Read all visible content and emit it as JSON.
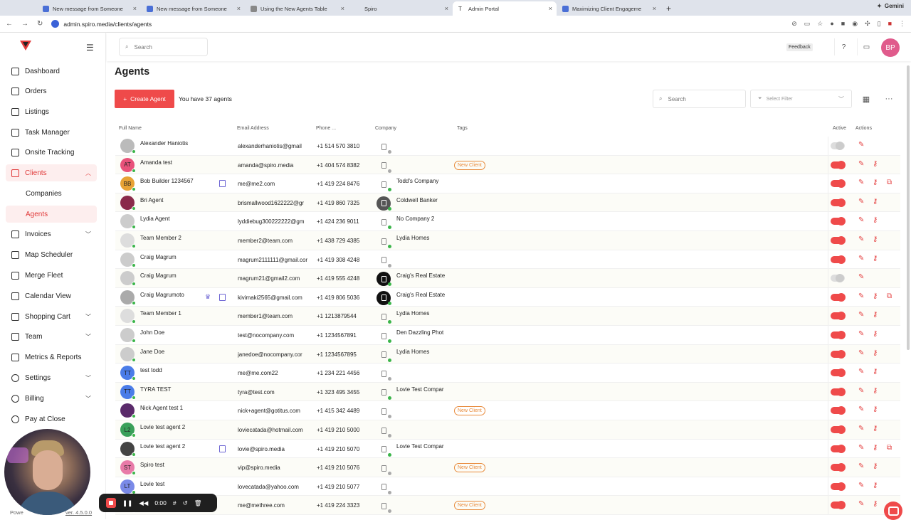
{
  "browser": {
    "tabs": [
      {
        "label": "New message from Someone"
      },
      {
        "label": "New message from Someone"
      },
      {
        "label": "Using the New Agents Table"
      },
      {
        "label": "Spiro"
      },
      {
        "label": "Admin Portal"
      },
      {
        "label": "Maximizing Client Engageme"
      }
    ],
    "gemini_label": "Gemini",
    "url": "admin.spiro.media/clients/agents"
  },
  "sidebar": {
    "items": [
      {
        "label": "Dashboard"
      },
      {
        "label": "Orders"
      },
      {
        "label": "Listings"
      },
      {
        "label": "Task Manager"
      },
      {
        "label": "Onsite Tracking"
      },
      {
        "label": "Clients"
      },
      {
        "label": "Companies"
      },
      {
        "label": "Agents"
      },
      {
        "label": "Invoices"
      },
      {
        "label": "Map Scheduler"
      },
      {
        "label": "Merge Fleet"
      },
      {
        "label": "Calendar View"
      },
      {
        "label": "Shopping Cart"
      },
      {
        "label": "Team"
      },
      {
        "label": "Metrics & Reports"
      },
      {
        "label": "Settings"
      },
      {
        "label": "Billing"
      },
      {
        "label": "Pay at Close"
      }
    ],
    "powered_label": "Powe",
    "version": "ver. 4.5.0.0"
  },
  "header": {
    "search_placeholder": "Search",
    "feedback_label": "Feedback",
    "avatar_initials": "BP"
  },
  "main": {
    "title": "Agents",
    "create_button": "Create Agent",
    "agent_count": "You have 37 agents",
    "search_placeholder": "Search",
    "filter_placeholder": "Select Filter",
    "columns": {
      "full_name": "Full Name",
      "email": "Email Address",
      "phone": "Phone ...",
      "company": "Company",
      "tags": "Tags",
      "active": "Active",
      "actions": "Actions"
    },
    "rows": [
      {
        "initials": "",
        "name": "Alexander Haniotis",
        "email": "alexanderhaniotis@gmail",
        "phone": "+1 514 570 3810",
        "company": "",
        "tag": "",
        "active": false
      },
      {
        "initials": "AT",
        "name": "Amanda test",
        "email": "amanda@spiro.media",
        "phone": "+1 404 574 8382",
        "company": "",
        "tag": "New Client",
        "active": true
      },
      {
        "initials": "BB",
        "name": "Bob Builder 1234567",
        "email": "me@me2.com",
        "phone": "+1 419 224 8476",
        "company": "Todd's Company",
        "tag": "",
        "active": true
      },
      {
        "initials": "",
        "name": "Bri Agent",
        "email": "brismallwood1622222@gr",
        "phone": "+1 419 860 7325",
        "company": "Coldwell Banker",
        "tag": "",
        "active": true
      },
      {
        "initials": "",
        "name": "Lydia Agent",
        "email": "lyddiebug300222222@gm",
        "phone": "+1 424 236 9011",
        "company": "No Company 2",
        "tag": "",
        "active": true
      },
      {
        "initials": "",
        "name": "Team Member 2",
        "email": "member2@team.com",
        "phone": "+1 438 729 4385",
        "company": "Lydia Homes",
        "tag": "",
        "active": true
      },
      {
        "initials": "",
        "name": "Craig Magrum",
        "email": "magrum2111111@gmail.cor",
        "phone": "+1 419 308 4248",
        "company": "",
        "tag": "",
        "active": true
      },
      {
        "initials": "",
        "name": "Craig Magrum",
        "email": "magrum21@gmail2.com",
        "phone": "+1 419 555 4248",
        "company": "Craig's Real Estate",
        "tag": "",
        "active": false
      },
      {
        "initials": "",
        "name": "Craig Magrumoto",
        "email": "kivimaki2565@gmail.com",
        "phone": "+1 419 806 5036",
        "company": "Craig's Real Estate",
        "tag": "",
        "active": true
      },
      {
        "initials": "",
        "name": "Team Member 1",
        "email": "member1@team.com",
        "phone": "+1 1213879544",
        "company": "Lydia Homes",
        "tag": "",
        "active": true
      },
      {
        "initials": "",
        "name": "John Doe",
        "email": "test@nocompany.com",
        "phone": "+1 1234567891",
        "company": "Den Dazzling Phot",
        "tag": "",
        "active": true
      },
      {
        "initials": "",
        "name": "Jane Doe",
        "email": "janedoe@nocompany.cor",
        "phone": "+1 1234567895",
        "company": "Lydia Homes",
        "tag": "",
        "active": true
      },
      {
        "initials": "TT",
        "name": "test todd",
        "email": "me@me.com22",
        "phone": "+1 234 221 4456",
        "company": "",
        "tag": "",
        "active": true
      },
      {
        "initials": "TT",
        "name": "TYRA TEST",
        "email": "tyra@test.com",
        "phone": "+1 323 495 3455",
        "company": "Lovie Test Compar",
        "tag": "",
        "active": true
      },
      {
        "initials": "",
        "name": "Nick Agent test 1",
        "email": "nick+agent@gotitus.com",
        "phone": "+1 415 342 4489",
        "company": "",
        "tag": "New Client",
        "active": true
      },
      {
        "initials": "L2",
        "name": "Lovie test agent 2",
        "email": "loviecatada@hotmail.com",
        "phone": "+1 419 210 5000",
        "company": "",
        "tag": "",
        "active": true
      },
      {
        "initials": "",
        "name": "Lovie test agent 2",
        "email": "lovie@spiro.media",
        "phone": "+1 419 210 5070",
        "company": "Lovie Test Compar",
        "tag": "",
        "active": true
      },
      {
        "initials": "ST",
        "name": "Spiro test",
        "email": "vip@spiro.media",
        "phone": "+1 419 210 5076",
        "company": "",
        "tag": "New Client",
        "active": true
      },
      {
        "initials": "LT",
        "name": "Lovie test",
        "email": "lovecatada@yahoo.com",
        "phone": "+1 419 210 5077",
        "company": "",
        "tag": "",
        "active": true
      },
      {
        "initials": "",
        "name": "",
        "email": "me@methree.com",
        "phone": "+1 419 224 3323",
        "company": "",
        "tag": "New Client",
        "active": true
      }
    ]
  },
  "recorder": {
    "time": "0:00"
  },
  "colors": {
    "accent": "#ef4a4a",
    "tag": "#e88a3a"
  }
}
